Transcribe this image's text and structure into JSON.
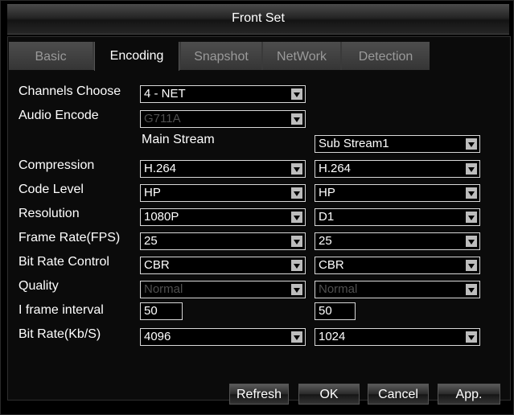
{
  "window": {
    "title": "Front Set"
  },
  "tabs": [
    "Basic",
    "Encoding",
    "Snapshot",
    "NetWork",
    "Detection"
  ],
  "active_tab": "Encoding",
  "channels_choose": {
    "label": "Channels Choose",
    "value": "4 - NET"
  },
  "audio_encode": {
    "label": "Audio Encode",
    "value": "G711A"
  },
  "streams": {
    "main": "Main Stream",
    "sub": "Sub Stream1"
  },
  "rows": [
    {
      "label": "Compression",
      "main": "H.264",
      "sub": "H.264"
    },
    {
      "label": "Code Level",
      "main": "HP",
      "sub": "HP"
    },
    {
      "label": "Resolution",
      "main": "1080P",
      "sub": "D1"
    },
    {
      "label": "Frame Rate(FPS)",
      "main": "25",
      "sub": "25"
    },
    {
      "label": "Bit Rate Control",
      "main": "CBR",
      "sub": "CBR"
    },
    {
      "label": "Quality",
      "main": "Normal",
      "sub": "Normal"
    },
    {
      "label": "I frame interval",
      "main": "50",
      "sub": "50"
    },
    {
      "label": "Bit Rate(Kb/S)",
      "main": "4096",
      "sub": "1024"
    }
  ],
  "buttons": {
    "refresh": "Refresh",
    "ok": "OK",
    "cancel": "Cancel",
    "apply": "App."
  }
}
